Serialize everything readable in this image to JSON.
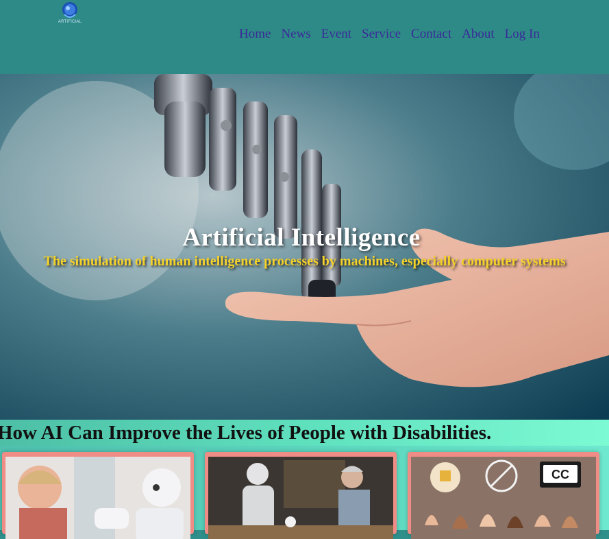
{
  "logo": {
    "text": "ARTIFICIAL",
    "icon": "robot-head-icon"
  },
  "nav": {
    "items": [
      "Home",
      "News",
      "Event",
      "Service",
      "Contact",
      "About",
      "Log In"
    ]
  },
  "hero": {
    "title": "Artificial Intelligence",
    "subtitle": "The simulation of human intelligence processes by machines, especially computer systems",
    "image": "robot-hand-touching-human-hand"
  },
  "section": {
    "title": "How AI Can Improve the Lives of People with Disabilities."
  },
  "cards": [
    {
      "image": "elderly-woman-with-robot"
    },
    {
      "image": "robot-serving-tea-to-elderly-woman"
    },
    {
      "image": "accessibility-icons-hands"
    }
  ],
  "colors": {
    "header": "#2e8a86",
    "nav_text": "#3a2a9a",
    "subtitle": "#f5d22a",
    "card_border": "#f08c86"
  }
}
